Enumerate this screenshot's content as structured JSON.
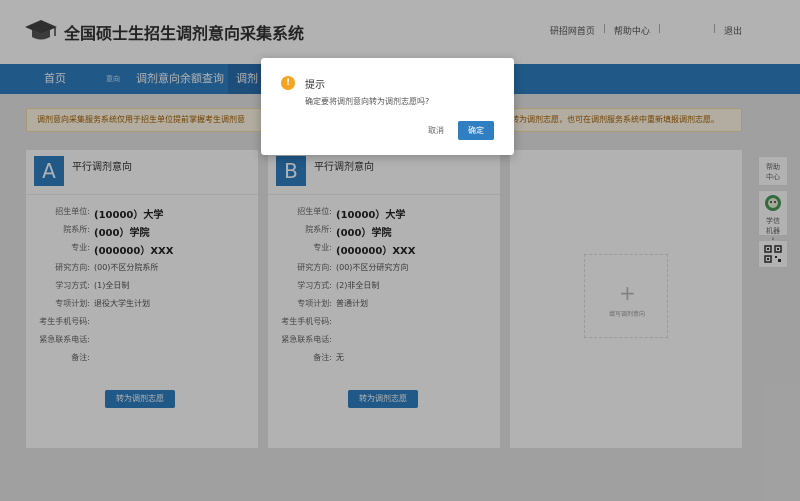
{
  "header": {
    "site_title": "全国硕士生招生调剂意向采集系统",
    "links": [
      "研招网首页",
      "帮助中心",
      "退出"
    ],
    "sep": "|"
  },
  "nav": {
    "home": "首页",
    "intent_small": "意向",
    "quota_query": "调剂意向余额查询",
    "active_item": "调剂"
  },
  "notice": {
    "text_left": "调剂意向采集服务系统仅用于招生单位提前掌握考生调剂意",
    "text_right": "转为调剂志愿，也可在调剂服务系统中重新填报调剂志愿。"
  },
  "cards": [
    {
      "badge": "A",
      "title": "平行调剂意向",
      "rows": [
        {
          "label": "招生单位:",
          "value": "(10000）大学"
        },
        {
          "label": "院系所:",
          "value": "(000）学院"
        },
        {
          "label": "专业:",
          "value": "(000000）XXX"
        },
        {
          "label": "研究方向:",
          "value": "(00)不区分院系所"
        },
        {
          "label": "学习方式:",
          "value": "(1)全日制"
        },
        {
          "label": "专项计划:",
          "value": "退役大学生计划"
        },
        {
          "label": "考生手机号码:",
          "value": ""
        },
        {
          "label": "紧急联系电话:",
          "value": ""
        },
        {
          "label": "备注:",
          "value": ""
        }
      ],
      "button": "转为调剂志愿"
    },
    {
      "badge": "B",
      "title": "平行调剂意向",
      "rows": [
        {
          "label": "招生单位:",
          "value": "(10000）大学"
        },
        {
          "label": "院系所:",
          "value": "(000）学院"
        },
        {
          "label": "专业:",
          "value": "(000000）XXX"
        },
        {
          "label": "研究方向:",
          "value": "(00)不区分研究方向"
        },
        {
          "label": "学习方式:",
          "value": "(2)非全日制"
        },
        {
          "label": "专项计划:",
          "value": "普通计划"
        },
        {
          "label": "考生手机号码:",
          "value": ""
        },
        {
          "label": "紧急联系电话:",
          "value": ""
        },
        {
          "label": "备注:",
          "value": "无"
        }
      ],
      "button": "转为调剂志愿"
    }
  ],
  "add_card": {
    "label": "填写调剂意向"
  },
  "side": {
    "help": "帮助中心",
    "robot": "学信机器人"
  },
  "dialog": {
    "title": "提示",
    "message": "确定要将调剂意向转为调剂志愿吗?",
    "cancel": "取消",
    "ok": "确定"
  },
  "colors": {
    "primary": "#2f7fc2",
    "warning": "#f7a51e",
    "notice_bg": "#fff8e6"
  },
  "icons": [
    "graduation-cap-icon",
    "warning-icon",
    "plus-icon",
    "robot-icon",
    "qrcode-icon"
  ]
}
